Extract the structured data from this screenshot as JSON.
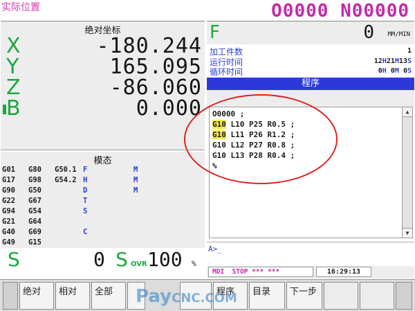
{
  "header": {
    "screen_title": "实际位置",
    "program_number": "O0000 N00000"
  },
  "coordinates": {
    "title": "绝对坐标",
    "axes": [
      {
        "name": "X",
        "value": "-180.244"
      },
      {
        "name": "Y",
        "value": "165.095"
      },
      {
        "name": "Z",
        "value": "-86.060"
      },
      {
        "name": "B",
        "value": "0.000"
      }
    ]
  },
  "modal": {
    "title": "模态",
    "col1": [
      "G01",
      "G17",
      "G90",
      "G22",
      "G94",
      "G21",
      "G40",
      "G49"
    ],
    "col2": [
      "G80",
      "G98",
      "G50",
      "G67",
      "G54",
      "G64",
      "G69",
      "G15"
    ],
    "col3": [
      "G50.1",
      "G54.2"
    ],
    "col4": [
      "F",
      "H",
      "D",
      "T",
      "S",
      "",
      "C"
    ],
    "col5": [
      "M",
      "M",
      "M"
    ]
  },
  "spindle": {
    "s_label": "S",
    "s_value": "0",
    "sovr_label": "S",
    "sovr_small": "OVR",
    "override_value": "100",
    "override_unit": "%"
  },
  "feed": {
    "label": "F",
    "value": "0",
    "unit": "MM/MIN"
  },
  "info": {
    "parts_label": "加工件数",
    "parts_value": "1",
    "run_time_label": "运行时间",
    "run_time_h": "12",
    "run_time_m": "21",
    "run_time_s": "13",
    "cycle_time_label": "循环时间",
    "cycle_time_h": "0",
    "cycle_time_m": "0",
    "cycle_time_s": "0",
    "unit_h": "H",
    "unit_m": "M",
    "unit_s": "S"
  },
  "program": {
    "header": "程序",
    "lines": [
      {
        "code": "G10",
        "rest": " L10 P25 R0.5 ;",
        "highlight": true
      },
      {
        "code": "G10",
        "rest": " L11 P26 R1.2 ;",
        "highlight": true
      },
      {
        "code": "G10",
        "rest": " L12 P27 R0.8 ;",
        "highlight": false
      },
      {
        "code": "G10",
        "rest": " L13 P28 R0.4 ;",
        "highlight": false
      }
    ],
    "first_line": "O0000 ;",
    "end_line": "%",
    "scroll_up": "▲",
    "scroll_down": "▼"
  },
  "input_line": {
    "prompt": "A>_"
  },
  "status": {
    "mode": "MDI  STOP *** ***",
    "time": "16:29:13"
  },
  "softkeys": {
    "left_edge": "",
    "absolute": "绝对",
    "relative": "相对",
    "all": "全部",
    "blank1": "",
    "blank2": "",
    "program": "程序",
    "directory": "目录",
    "next_step": "下一步",
    "faded1": "",
    "faded2": "",
    "right_edge": ""
  },
  "watermark": {
    "part1": "Pay",
    "part2": "CNC.COM"
  },
  "colors": {
    "axis_green": "#1da83f",
    "header_magenta": "#c42aa8",
    "program_header_blue": "#2c39d8",
    "label_blue": "#2a3fd1",
    "highlight_yellow": "#f4e94a",
    "annotation_red": "#e02020"
  }
}
